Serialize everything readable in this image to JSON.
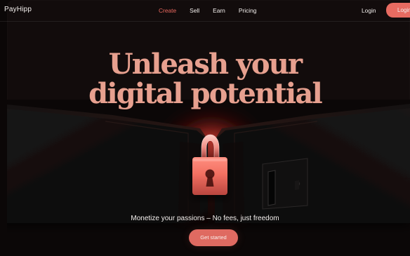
{
  "brand": {
    "logo_text": "PayHipp"
  },
  "nav": {
    "items": [
      {
        "label": "Create",
        "active": true
      },
      {
        "label": "Sell",
        "active": false
      },
      {
        "label": "Earn",
        "active": false
      },
      {
        "label": "Pricing",
        "active": false
      }
    ],
    "login_label": "Login",
    "cta_label": "Login"
  },
  "hero": {
    "title_line_1": "Unleash your",
    "title_line_2": "digital potential",
    "subtitle": "Monetize your passions – No fees, just freedom",
    "cta_label": "Get started"
  },
  "colors": {
    "accent": "#e76b61",
    "headline": "#e7a08f",
    "background": "#0b0707"
  },
  "icons": {
    "hero_lock": "padlock-icon",
    "keyhole": "keyhole-icon",
    "latch": "latch-icon"
  }
}
